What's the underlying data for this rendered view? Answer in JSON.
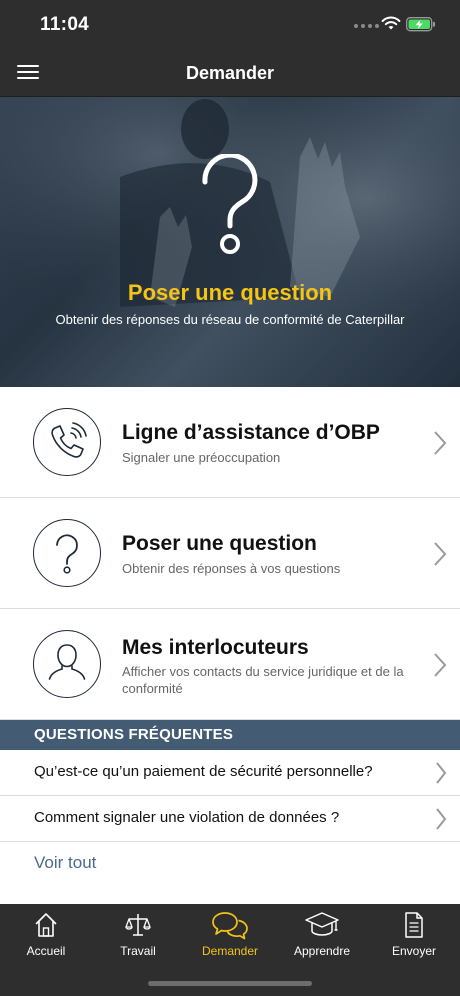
{
  "status_bar": {
    "time": "11:04",
    "icons": [
      "signal-dots-icon",
      "wifi-icon",
      "battery-charging-icon"
    ]
  },
  "nav": {
    "title": "Demander",
    "menu_icon": "hamburger-menu-icon"
  },
  "hero": {
    "icon": "question-mark-icon",
    "title": "Poser une question",
    "subtitle": "Obtenir des réponses du réseau de conformité de Caterpillar"
  },
  "actions": [
    {
      "icon": "phone-ringing-icon",
      "title": "Ligne d’assistance d’OBP",
      "description": "Signaler une préoccupation"
    },
    {
      "icon": "question-circle-icon",
      "title": "Poser une question",
      "description": "Obtenir des réponses à vos questions"
    },
    {
      "icon": "person-icon",
      "title": "Mes interlocuteurs",
      "description": "Afficher vos contacts du service juridique et de la conformité"
    }
  ],
  "faq": {
    "header": "QUESTIONS FRÉQUENTES",
    "items": [
      "Qu’est-ce qu’un paiement de sécurité personnelle?",
      "Comment signaler une violation de données ?"
    ],
    "see_all": "Voir tout"
  },
  "tabs": [
    {
      "icon": "house-icon",
      "label": "Accueil",
      "active": false
    },
    {
      "icon": "scales-icon",
      "label": "Travail",
      "active": false
    },
    {
      "icon": "chat-bubbles-icon",
      "label": "Demander",
      "active": true
    },
    {
      "icon": "graduation-cap-icon",
      "label": "Apprendre",
      "active": false
    },
    {
      "icon": "document-icon",
      "label": "Envoyer",
      "active": false
    }
  ],
  "colors": {
    "accent": "#f6c415",
    "bar": "#2e2e2e",
    "faq_header": "#445b74",
    "link": "#4a6a8c"
  }
}
